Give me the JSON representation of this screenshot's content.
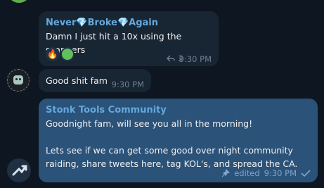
{
  "messages": [
    {
      "sender": "Never💎Broke💎Again",
      "text": "Damn I just hit a 10x using the scanners",
      "reactions": [
        "fire",
        "green-circle"
      ],
      "reply_count": "2",
      "time": "9:30 PM"
    },
    {
      "text": "Good shit fam",
      "time": "9:30 PM"
    },
    {
      "sender": "Stonk Tools Community",
      "text": "Goodnight fam, will see you all in the morning!\n\nLets see if we can get some good over night community raiding, share tweets here, tag KOL's, and spread the CA.",
      "status": "edited",
      "time": "9:30 PM"
    }
  ],
  "colors": {
    "background": "#0e1621",
    "incoming_bubble": "#182533",
    "outgoing_bubble": "#2b5278",
    "sender_name": "#64a8dd"
  },
  "icons": [
    "reply-arrow-icon",
    "pin-icon",
    "checkmark-icon"
  ]
}
